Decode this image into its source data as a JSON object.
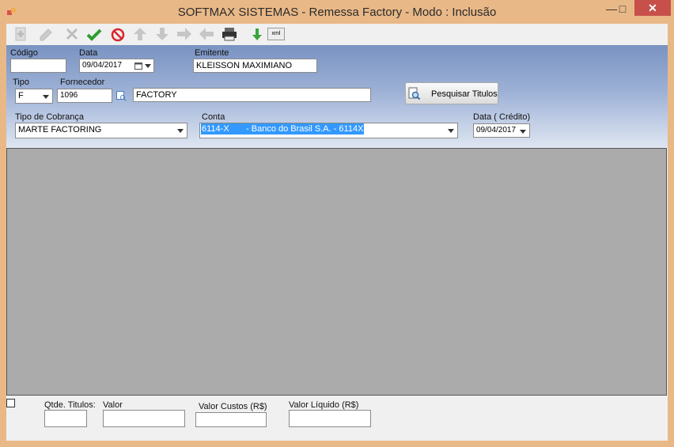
{
  "window": {
    "title": "SOFTMAX SISTEMAS - Remessa Factory  - Modo : Inclusão",
    "minimize": "—",
    "maximize": "□",
    "close": "✕"
  },
  "toolbar": {
    "xml_label": "xml"
  },
  "form": {
    "codigo": {
      "label": "Código",
      "value": ""
    },
    "data": {
      "label": "Data",
      "value": "09/04/2017"
    },
    "emitente": {
      "label": "Emitente",
      "value": "KLEISSON MAXIMIANO"
    },
    "tipo": {
      "label": "Tipo",
      "value": "F"
    },
    "fornecedor": {
      "label": "Fornecedor",
      "code": "1096",
      "name": "FACTORY"
    },
    "pesquisar_button": "Pesquisar Titulos",
    "tipo_cobranca": {
      "label": "Tipo de Cobrança",
      "value": "MARTE FACTORING"
    },
    "conta": {
      "label": "Conta",
      "value": "6114-X       - Banco do Brasil S.A. - 6114X"
    },
    "data_credito": {
      "label": "Data ( Crédito)",
      "value": "09/04/2017"
    }
  },
  "footer": {
    "qtde_titulos": {
      "label": "Qtde. Titulos:",
      "value": ""
    },
    "valor": {
      "label": "Valor",
      "value": ""
    },
    "valor_custos": {
      "label": "Valor Custos (R$)",
      "value": ""
    },
    "valor_liquido": {
      "label": "Valor Líquido (R$)",
      "value": ""
    }
  },
  "colors": {
    "title_bar": "#e9b887",
    "close_button": "#c7504b",
    "form_gradient_top": "#7993c2",
    "grid_background": "#ababab",
    "selection": "#3399ff"
  }
}
